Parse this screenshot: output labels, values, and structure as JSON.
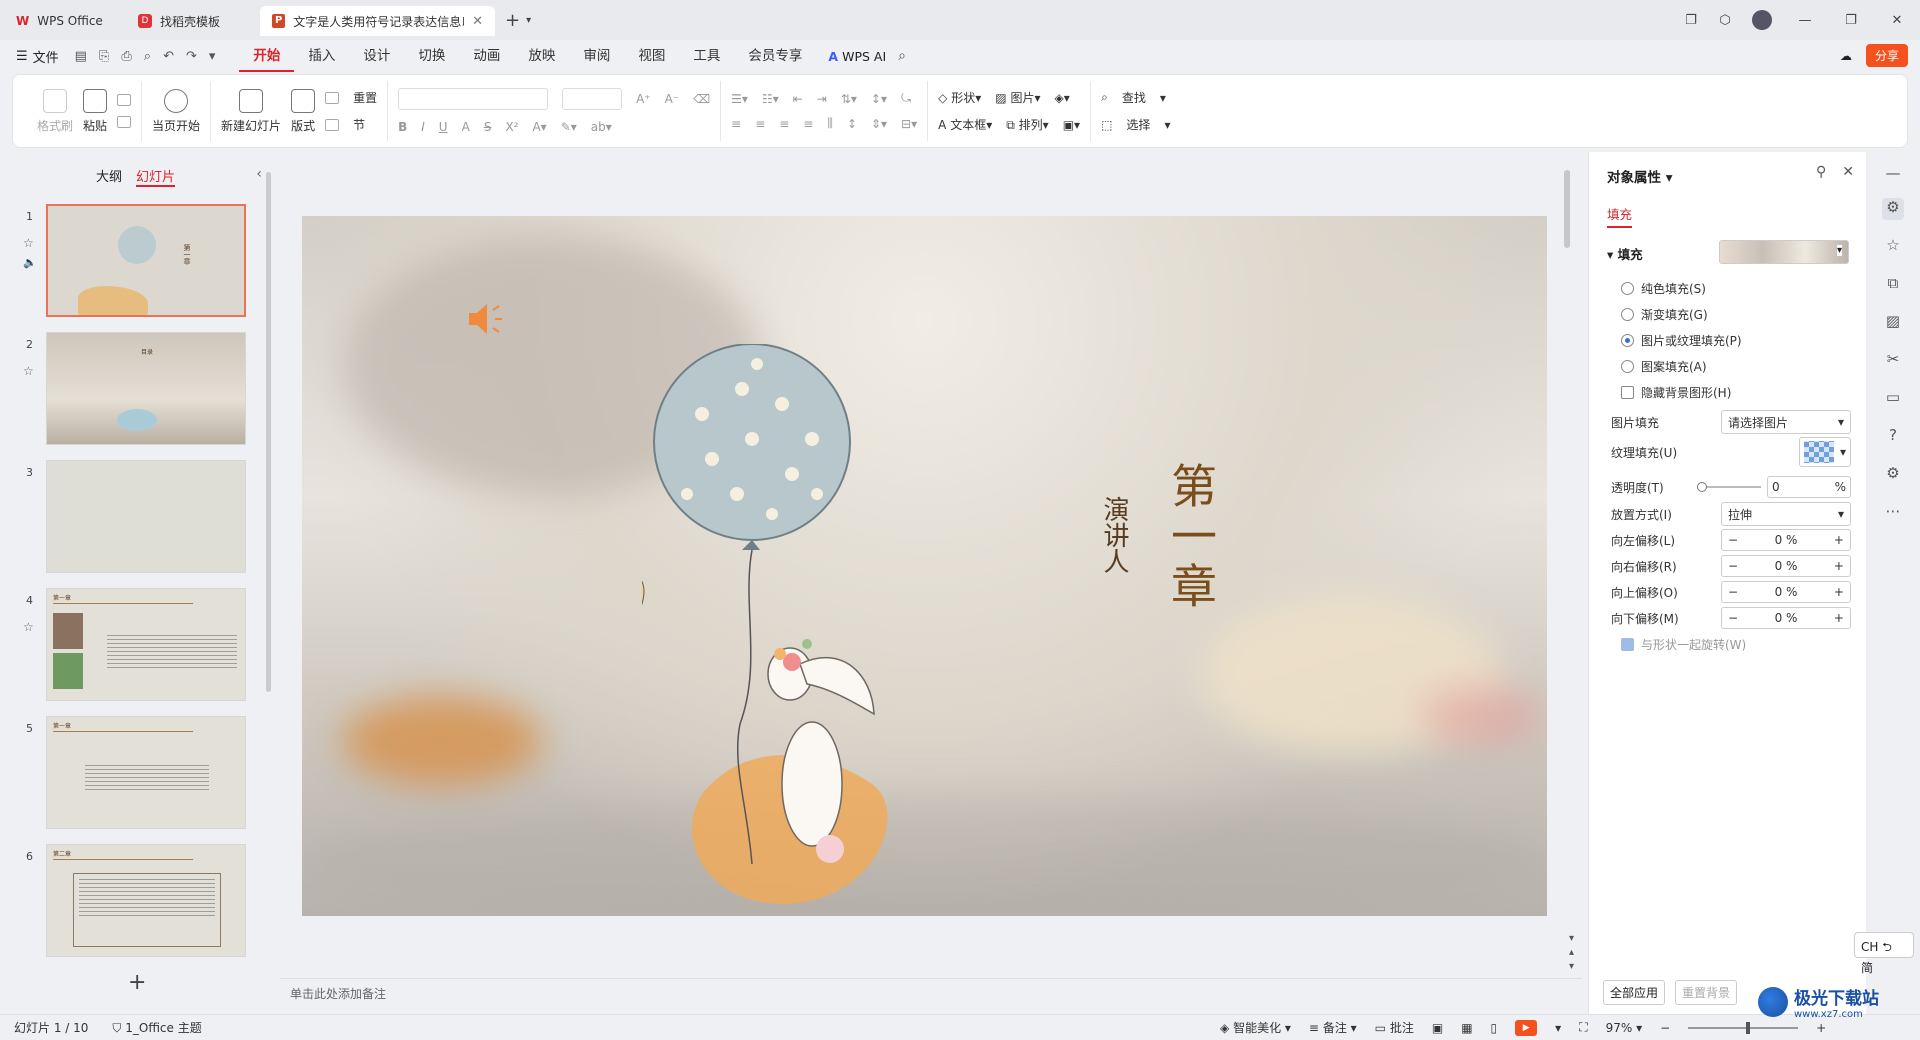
{
  "tabbar": {
    "home_tab": "WPS Office",
    "template_tab": "找稻壳模板",
    "doc_tab": "文字是人类用符号记录表达信息以"
  },
  "menubar": {
    "file_label": "文件",
    "tabs": [
      "开始",
      "插入",
      "设计",
      "切换",
      "动画",
      "放映",
      "审阅",
      "视图",
      "工具",
      "会员专享"
    ],
    "active_tab": "开始",
    "wps_ai": "WPS AI",
    "share": "分享"
  },
  "ribbon": {
    "format_painter": "格式刷",
    "paste": "粘贴",
    "play_from_current": "当页开始",
    "new_slide": "新建幻灯片",
    "layout": "版式",
    "section": "节",
    "reset": "重置",
    "shape": "形状",
    "picture": "图片",
    "textbox": "文本框",
    "arrange": "排列",
    "find": "查找",
    "select": "选择"
  },
  "left_panel": {
    "tabs": [
      "大纲",
      "幻灯片"
    ],
    "active_tab": "幻灯片",
    "slides": [
      {
        "num": "1",
        "title": "第一章"
      },
      {
        "num": "2",
        "title": "目录"
      },
      {
        "num": "3",
        "title": ""
      },
      {
        "num": "4",
        "title": "第一章"
      },
      {
        "num": "5",
        "title": "第一章"
      },
      {
        "num": "6",
        "title": "第二章"
      }
    ]
  },
  "slide": {
    "title": "第一章",
    "subtitle": "演讲人"
  },
  "notes_placeholder": "单击此处添加备注",
  "right_panel": {
    "header": "对象属性",
    "subtab": "填充",
    "section": "填充",
    "fill_options": [
      "纯色填充(S)",
      "渐变填充(G)",
      "图片或纹理填充(P)",
      "图案填充(A)"
    ],
    "selected_fill": "图片或纹理填充(P)",
    "hide_bg": "隐藏背景图形(H)",
    "picture_fill_label": "图片填充",
    "picture_fill_value": "请选择图片",
    "texture_fill_label": "纹理填充(U)",
    "transparency_label": "透明度(T)",
    "transparency_value": "0",
    "transparency_unit": "%",
    "placement_label": "放置方式(I)",
    "placement_value": "拉伸",
    "offsets": [
      {
        "label": "向左偏移(L)",
        "value": "0 %"
      },
      {
        "label": "向右偏移(R)",
        "value": "0 %"
      },
      {
        "label": "向上偏移(O)",
        "value": "0 %"
      },
      {
        "label": "向下偏移(M)",
        "value": "0 %"
      }
    ],
    "rotate_with_shape": "与形状一起旋转(W)",
    "apply_all": "全部应用",
    "reset_bg": "重置背景"
  },
  "ime": "CH ⮌ 简",
  "statusbar": {
    "slide_info": "幻灯片 1 / 10",
    "theme": "1_Office 主题",
    "beautify": "智能美化",
    "notes": "备注",
    "comments": "批注",
    "zoom": "97%"
  },
  "watermark": {
    "title": "极光下载站",
    "url": "www.xz7.com"
  },
  "colors": {
    "accent": "#d8242a",
    "share": "#f4511e",
    "title_brown": "#7a4e1c"
  }
}
